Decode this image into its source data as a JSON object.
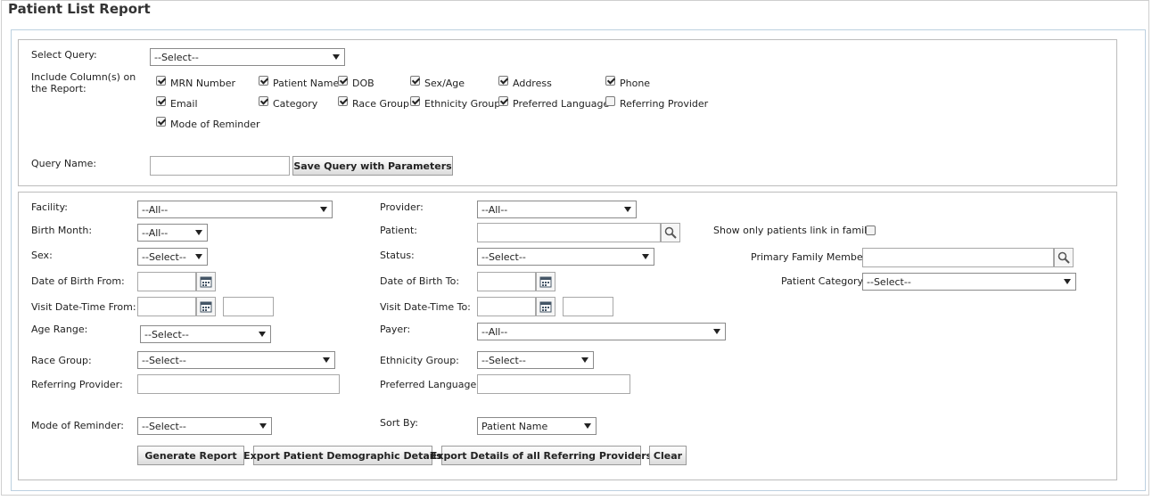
{
  "title": "Patient List Report",
  "query": {
    "select_query_label": "Select Query:",
    "select_query_value": "--Select--",
    "include_columns_label": "Include Column(s) on the Report:",
    "columns": [
      {
        "label": "MRN Number",
        "checked": true
      },
      {
        "label": "Patient Name",
        "checked": true
      },
      {
        "label": "DOB",
        "checked": true
      },
      {
        "label": "Sex/Age",
        "checked": true
      },
      {
        "label": "Address",
        "checked": true
      },
      {
        "label": "Phone",
        "checked": true
      },
      {
        "label": "Email",
        "checked": true
      },
      {
        "label": "Category",
        "checked": true
      },
      {
        "label": "Race Group",
        "checked": true
      },
      {
        "label": "Ethnicity Group",
        "checked": true
      },
      {
        "label": "Preferred Language",
        "checked": true
      },
      {
        "label": "Referring Provider",
        "checked": false
      },
      {
        "label": "Mode of Reminder",
        "checked": true
      }
    ],
    "query_name_label": "Query Name:",
    "query_name_value": "",
    "save_button": "Save Query with Parameters"
  },
  "filters": {
    "facility_label": "Facility:",
    "facility_value": "--All--",
    "provider_label": "Provider:",
    "provider_value": "--All--",
    "birth_month_label": "Birth Month:",
    "birth_month_value": "--All--",
    "patient_label": "Patient:",
    "patient_value": "",
    "show_family_label": "Show only patients link in family:",
    "show_family_checked": false,
    "sex_label": "Sex:",
    "sex_value": "--Select--",
    "status_label": "Status:",
    "status_value": "--Select--",
    "primary_family_label": "Primary Family Member:",
    "primary_family_value": "",
    "dob_from_label": "Date of Birth From:",
    "dob_from_value": "",
    "dob_to_label": "Date of Birth To:",
    "dob_to_value": "",
    "patient_category_label": "Patient Category:",
    "patient_category_value": "--Select--",
    "visit_from_label": "Visit Date-Time From:",
    "visit_from_value": "",
    "visit_from_time": "",
    "visit_to_label": "Visit Date-Time To:",
    "visit_to_value": "",
    "visit_to_time": "",
    "age_range_label": "Age Range:",
    "age_range_value": "--Select--",
    "payer_label": "Payer:",
    "payer_value": "--All--",
    "race_label": "Race Group:",
    "race_value": "--Select--",
    "ethnicity_label": "Ethnicity Group:",
    "ethnicity_value": "--Select--",
    "referring_label": "Referring Provider:",
    "referring_value": "",
    "preferred_lang_label": "Preferred Language:",
    "preferred_lang_value": "",
    "reminder_label": "Mode of Reminder:",
    "reminder_value": "--Select--",
    "sort_label": "Sort By:",
    "sort_value": "Patient Name"
  },
  "buttons": {
    "generate": "Generate Report",
    "export_demo": "Export Patient Demographic Details",
    "export_ref": "Export Details of all Referring Providers",
    "clear": "Clear"
  }
}
